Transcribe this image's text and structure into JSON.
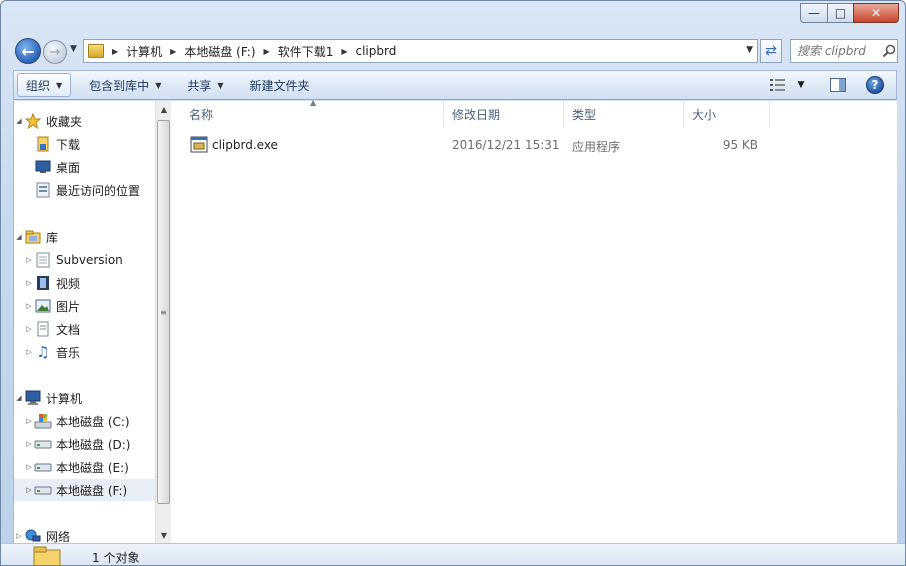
{
  "window": {
    "controls": {
      "minimize": "—",
      "maximize": "□",
      "close": "✕"
    }
  },
  "address": {
    "crumbs": [
      "计算机",
      "本地磁盘 (F:)",
      "软件下载1",
      "clipbrd"
    ]
  },
  "search": {
    "placeholder": "搜索 clipbrd"
  },
  "toolbar": {
    "organize": "组织",
    "include_library": "包含到库中",
    "share": "共享",
    "new_folder": "新建文件夹"
  },
  "nav": {
    "favorites": {
      "label": "收藏夹",
      "items": [
        "下载",
        "桌面",
        "最近访问的位置"
      ]
    },
    "libraries": {
      "label": "库",
      "items": [
        "Subversion",
        "视频",
        "图片",
        "文档",
        "音乐"
      ]
    },
    "computer": {
      "label": "计算机",
      "items": [
        "本地磁盘 (C:)",
        "本地磁盘 (D:)",
        "本地磁盘 (E:)",
        "本地磁盘 (F:)"
      ]
    },
    "network": {
      "label": "网络"
    }
  },
  "columns": {
    "name": "名称",
    "modified": "修改日期",
    "type": "类型",
    "size": "大小"
  },
  "files": [
    {
      "name": "clipbrd.exe",
      "modified": "2016/12/21 15:31",
      "type": "应用程序",
      "size": "95 KB"
    }
  ],
  "status": {
    "text": "1 个对象"
  },
  "icons": {
    "folder": "folder-icon",
    "star": "star-icon",
    "drive": "drive-icon",
    "network": "network-icon",
    "computer": "computer-icon",
    "exe": "exe-icon"
  },
  "colors": {
    "accent": "#1d4f9c",
    "selected_bg": "#e8eef5",
    "header_text": "#4c607a"
  }
}
